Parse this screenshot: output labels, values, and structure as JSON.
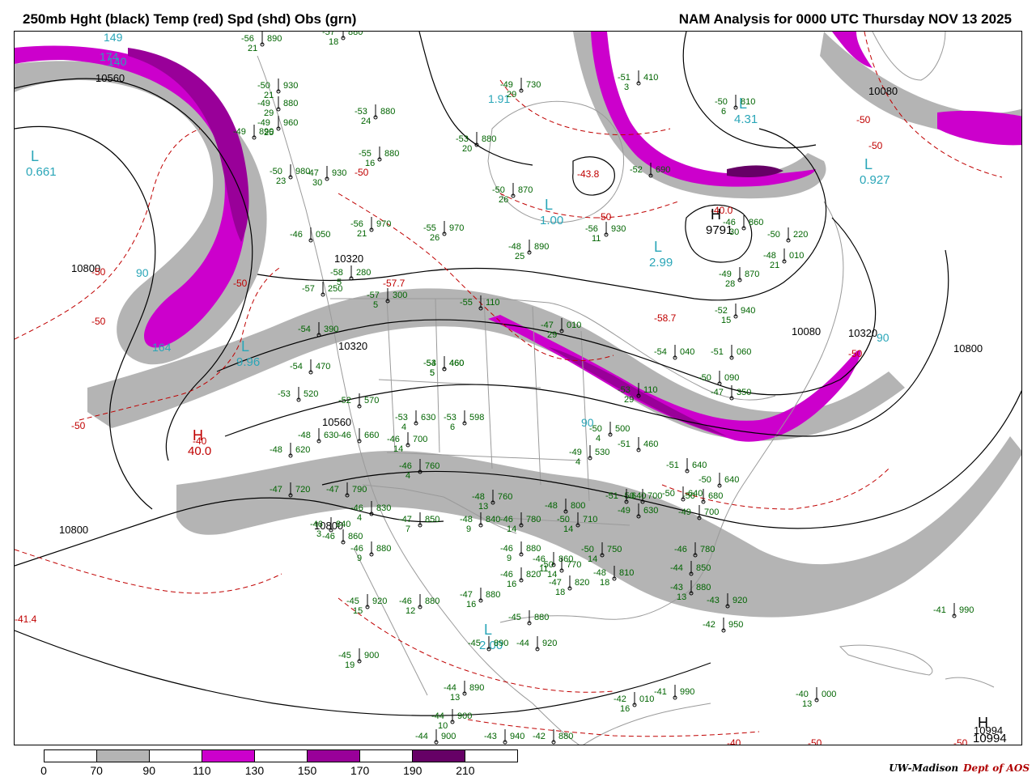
{
  "header": {
    "left_title": "250mb Hght (black) Temp (red) Spd (shd) Obs (grn)",
    "right_title": "NAM Analysis for 0000 UTC Thursday  NOV 13 2025"
  },
  "colors": {
    "height": "#000000",
    "temp": "#c00000",
    "obs": "#006400",
    "centers": "#2aa6b8",
    "borders": "#9a9a9a",
    "speed_70": "#b4b4b4",
    "speed_110": "#cc00cc",
    "speed_150": "#990099",
    "speed_190": "#660066"
  },
  "colorbar": {
    "labels": [
      "0",
      "70",
      "90",
      "110",
      "130",
      "150",
      "170",
      "190",
      "210"
    ],
    "fills": [
      "#ffffff",
      "#b4b4b4",
      "#ffffff",
      "#cc00cc",
      "#ffffff",
      "#990099",
      "#ffffff",
      "#660066",
      "#ffffff"
    ]
  },
  "credit": {
    "org": "UW-Madison",
    "dept": "Dept of AOS"
  },
  "height_labels": [
    "10560",
    "10800",
    "10800",
    "10320",
    "10080",
    "10560",
    "10800",
    "10320",
    "10080",
    "10320",
    "10800",
    "10994"
  ],
  "temp_labels": [
    "-50",
    "-50",
    "-50",
    "-50",
    "-50",
    "-50",
    "-50",
    "-50",
    "-50",
    "-50",
    "-50",
    "-40",
    "-40",
    "-40.0",
    "-57.7",
    "-58.7",
    "-43.8",
    "-41.4"
  ],
  "centers": [
    {
      "letter": "L",
      "value": "0.661"
    },
    {
      "letter": "L",
      "value": "9.96"
    },
    {
      "letter": "H",
      "value": "40.0"
    },
    {
      "letter": "L",
      "value": "1.00"
    },
    {
      "letter": "L",
      "value": "2.99"
    },
    {
      "letter": "L",
      "value": "4.31"
    },
    {
      "letter": "L",
      "value": "0.927"
    },
    {
      "letter": "L",
      "value": "2.00"
    },
    {
      "letter": "H",
      "value": "9791"
    },
    {
      "letter": "H",
      "value": "10994"
    }
  ],
  "speed_labels": [
    "90",
    "90",
    "90",
    "174",
    "149",
    "140",
    "164",
    "1.91"
  ],
  "observations": [
    {
      "temp": "-50",
      "hgt": "930",
      "dew": "21"
    },
    {
      "temp": "-49",
      "hgt": "880",
      "dew": "29"
    },
    {
      "temp": "-49",
      "hgt": "960",
      "dew": "25"
    },
    {
      "temp": "-49",
      "hgt": "890",
      "dew": ""
    },
    {
      "temp": "-50",
      "hgt": "980",
      "dew": "23"
    },
    {
      "temp": "-47",
      "hgt": "930",
      "dew": "30"
    },
    {
      "temp": "-57",
      "hgt": "880",
      "dew": "18"
    },
    {
      "temp": "-56",
      "hgt": "890",
      "dew": "21"
    },
    {
      "temp": "-53",
      "hgt": "880",
      "dew": "24"
    },
    {
      "temp": "-55",
      "hgt": "880",
      "dew": "16"
    },
    {
      "temp": "-53",
      "hgt": "880",
      "dew": "20"
    },
    {
      "temp": "-50",
      "hgt": "870",
      "dew": "26"
    },
    {
      "temp": "-49",
      "hgt": "730",
      "dew": "29"
    },
    {
      "temp": "-46",
      "hgt": "050",
      "dew": ""
    },
    {
      "temp": "-56",
      "hgt": "970",
      "dew": "21"
    },
    {
      "temp": "-55",
      "hgt": "970",
      "dew": "26"
    },
    {
      "temp": "-48",
      "hgt": "890",
      "dew": "25"
    },
    {
      "temp": "-56",
      "hgt": "930",
      "dew": "11"
    },
    {
      "temp": "-58",
      "hgt": "280",
      "dew": "5"
    },
    {
      "temp": "-57",
      "hgt": "250",
      "dew": ""
    },
    {
      "temp": "-54",
      "hgt": "390",
      "dew": ""
    },
    {
      "temp": "-54",
      "hgt": "470",
      "dew": ""
    },
    {
      "temp": "-53",
      "hgt": "520",
      "dew": ""
    },
    {
      "temp": "-52",
      "hgt": "570",
      "dew": ""
    },
    {
      "temp": "-48",
      "hgt": "630",
      "dew": ""
    },
    {
      "temp": "-46",
      "hgt": "660",
      "dew": ""
    },
    {
      "temp": "-46",
      "hgt": "700",
      "dew": "14"
    },
    {
      "temp": "-46",
      "hgt": "760",
      "dew": "4"
    },
    {
      "temp": "-48",
      "hgt": "620",
      "dew": ""
    },
    {
      "temp": "-47",
      "hgt": "720",
      "dew": ""
    },
    {
      "temp": "-47",
      "hgt": "790",
      "dew": ""
    },
    {
      "temp": "-46",
      "hgt": "830",
      "dew": "4"
    },
    {
      "temp": "-46",
      "hgt": "840",
      "dew": "3"
    },
    {
      "temp": "-46",
      "hgt": "860",
      "dew": ""
    },
    {
      "temp": "-46",
      "hgt": "880",
      "dew": "9"
    },
    {
      "temp": "-47",
      "hgt": "850",
      "dew": "7"
    },
    {
      "temp": "-48",
      "hgt": "840",
      "dew": "9"
    },
    {
      "temp": "-46",
      "hgt": "780",
      "dew": "14"
    },
    {
      "temp": "-50",
      "hgt": "710",
      "dew": "14"
    },
    {
      "temp": "-46",
      "hgt": "880",
      "dew": "9"
    },
    {
      "temp": "-46",
      "hgt": "860",
      "dew": "11"
    },
    {
      "temp": "-46",
      "hgt": "820",
      "dew": "16"
    },
    {
      "temp": "-50",
      "hgt": "770",
      "dew": "14"
    },
    {
      "temp": "-50",
      "hgt": "750",
      "dew": "14"
    },
    {
      "temp": "-47",
      "hgt": "820",
      "dew": "18"
    },
    {
      "temp": "-48",
      "hgt": "810",
      "dew": "18"
    },
    {
      "temp": "-45",
      "hgt": "920",
      "dew": "15"
    },
    {
      "temp": "-46",
      "hgt": "880",
      "dew": "12"
    },
    {
      "temp": "-47",
      "hgt": "880",
      "dew": "16"
    },
    {
      "temp": "-45",
      "hgt": "880",
      "dew": ""
    },
    {
      "temp": "-45",
      "hgt": "890",
      "dew": ""
    },
    {
      "temp": "-44",
      "hgt": "920",
      "dew": ""
    },
    {
      "temp": "-45",
      "hgt": "900",
      "dew": "19"
    },
    {
      "temp": "-44",
      "hgt": "890",
      "dew": "13"
    },
    {
      "temp": "-44",
      "hgt": "900",
      "dew": "10"
    },
    {
      "temp": "-44",
      "hgt": "900",
      "dew": ""
    },
    {
      "temp": "-43",
      "hgt": "940",
      "dew": ""
    },
    {
      "temp": "-42",
      "hgt": "880",
      "dew": ""
    },
    {
      "temp": "-42",
      "hgt": "010",
      "dew": "16"
    },
    {
      "temp": "-41",
      "hgt": "990",
      "dew": ""
    },
    {
      "temp": "-40",
      "hgt": "000",
      "dew": "13"
    },
    {
      "temp": "-41",
      "hgt": "990",
      "dew": ""
    },
    {
      "temp": "-42",
      "hgt": "950",
      "dew": ""
    },
    {
      "temp": "-43",
      "hgt": "920",
      "dew": ""
    },
    {
      "temp": "-43",
      "hgt": "880",
      "dew": "13"
    },
    {
      "temp": "-44",
      "hgt": "850",
      "dew": ""
    },
    {
      "temp": "-46",
      "hgt": "780",
      "dew": ""
    },
    {
      "temp": "-49",
      "hgt": "700",
      "dew": ""
    },
    {
      "temp": "-50",
      "hgt": "680",
      "dew": ""
    },
    {
      "temp": "-50",
      "hgt": "640",
      "dew": ""
    },
    {
      "temp": "-51",
      "hgt": "640",
      "dew": ""
    },
    {
      "temp": "-50",
      "hgt": "700",
      "dew": ""
    },
    {
      "temp": "-49",
      "hgt": "630",
      "dew": ""
    },
    {
      "temp": "-48",
      "hgt": "760",
      "dew": "13"
    },
    {
      "temp": "-48",
      "hgt": "800",
      "dew": ""
    },
    {
      "temp": "-49",
      "hgt": "530",
      "dew": "4"
    },
    {
      "temp": "-51",
      "hgt": "460",
      "dew": ""
    },
    {
      "temp": "-50",
      "hgt": "500",
      "dew": "4"
    },
    {
      "temp": "-55",
      "hgt": "110",
      "dew": ""
    },
    {
      "temp": "-47",
      "hgt": "010",
      "dew": "29"
    },
    {
      "temp": "-53",
      "hgt": "110",
      "dew": "29"
    },
    {
      "temp": "-54",
      "hgt": "040",
      "dew": ""
    },
    {
      "temp": "-51",
      "hgt": "060",
      "dew": ""
    },
    {
      "temp": "-50",
      "hgt": "090",
      "dew": ""
    },
    {
      "temp": "-47",
      "hgt": "350",
      "dew": ""
    },
    {
      "temp": "-52",
      "hgt": "940",
      "dew": "15"
    },
    {
      "temp": "-49",
      "hgt": "870",
      "dew": "28"
    },
    {
      "temp": "-48",
      "hgt": "010",
      "dew": "21"
    },
    {
      "temp": "-50",
      "hgt": "220",
      "dew": ""
    },
    {
      "temp": "-46",
      "hgt": "860",
      "dew": "30"
    },
    {
      "temp": "-51",
      "hgt": "410",
      "dew": "3"
    },
    {
      "temp": "-50",
      "hgt": "810",
      "dew": "6"
    },
    {
      "temp": "-52",
      "hgt": "690",
      "dew": ""
    },
    {
      "temp": "-53",
      "hgt": "630",
      "dew": "4"
    },
    {
      "temp": "-53",
      "hgt": "598",
      "dew": "6"
    },
    {
      "temp": "-53",
      "hgt": "460",
      "dew": "5"
    },
    {
      "temp": "-54",
      "hgt": "460",
      "dew": "5"
    },
    {
      "temp": "-57",
      "hgt": "300",
      "dew": "5"
    },
    {
      "temp": "-50",
      "hgt": "640",
      "dew": ""
    },
    {
      "temp": "-51",
      "hgt": "640",
      "dew": ""
    }
  ]
}
